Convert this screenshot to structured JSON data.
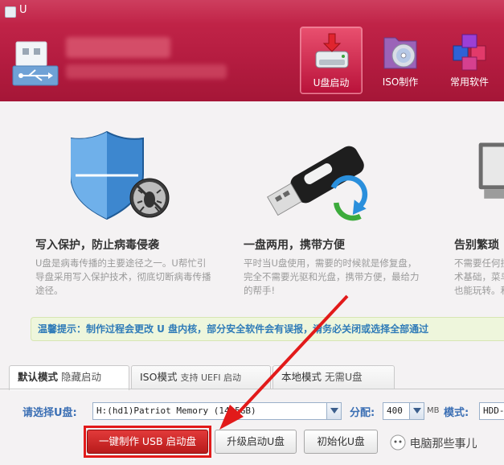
{
  "window": {
    "title": "U"
  },
  "toolbar": {
    "items": [
      {
        "label": "U盘启动",
        "icon": "usb-drive-icon",
        "active": true
      },
      {
        "label": "ISO制作",
        "icon": "disc-folder-icon",
        "active": false
      },
      {
        "label": "常用软件",
        "icon": "cubes-icon",
        "active": false
      }
    ]
  },
  "features": [
    {
      "title": "写入保护，防止病毒侵袭",
      "desc": "U盘是病毒传播的主要途径之一。U帮忙引导盘采用写入保护技术，彻底切断病毒传播途径。",
      "icon": "shield-bug-icon"
    },
    {
      "title": "一盘两用，携带方便",
      "desc": "平时当U盘使用，需要的时候就是修复盘，完全不需要光驱和光盘，携带方便，最给力的帮手!",
      "icon": "usb-stick-icon"
    },
    {
      "title": "告别繁琐",
      "desc": "不需要任何技术基础，菜鸟也能玩转。和笨重的光驱说拜拜，实现全民普及",
      "icon": "monitor-icon"
    }
  ],
  "tip": {
    "text": "温馨提示：制作过程会更改 U 盘内核，部分安全软件会有误报，请务必关闭或选择全部通过"
  },
  "tabs": [
    {
      "label": "默认模式",
      "sub": "隐藏启动",
      "active": true
    },
    {
      "label": "ISO模式",
      "sub": "支持 UEFI 启动",
      "active": false
    },
    {
      "label": "本地模式",
      "sub": "无需U盘",
      "active": false
    }
  ],
  "form": {
    "disk_label": "请选择U盘:",
    "disk_value": "H:(hd1)Patriot Memory (14.5GB)",
    "alloc_label": "分配:",
    "alloc_value": "400",
    "alloc_unit": "MB",
    "mode_label": "模式:",
    "mode_value": "HDD-"
  },
  "buttons": {
    "make": "一键制作 USB 启动盘",
    "upgrade": "升级启动U盘",
    "init": "初始化U盘"
  },
  "watermark": {
    "text": "电脑那些事儿"
  },
  "colors": {
    "header": "#b41c40",
    "primary_button": "#c82323",
    "highlight": "#e21a1a",
    "tip_text": "#2f7bb8",
    "label_blue": "#3b6fb4"
  }
}
